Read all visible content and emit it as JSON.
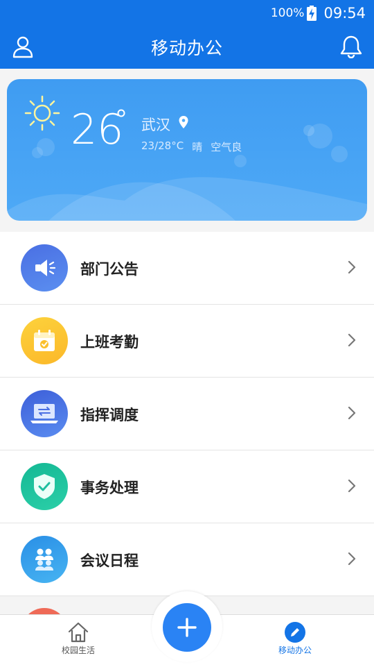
{
  "status_bar": {
    "battery": "100%",
    "time": "09:54"
  },
  "header": {
    "title": "移动办公"
  },
  "weather": {
    "temperature": "26",
    "city": "武汉",
    "range": "23/28°C",
    "condition": "晴",
    "air": "空气良"
  },
  "menu": [
    {
      "label": "部门公告",
      "icon": "megaphone-icon",
      "color": "#4a6fe3"
    },
    {
      "label": "上班考勤",
      "icon": "calendar-check-icon",
      "color": "#fbc02d"
    },
    {
      "label": "指挥调度",
      "icon": "laptop-transfer-icon",
      "color": "#3f6ee0"
    },
    {
      "label": "事务处理",
      "icon": "shield-check-icon",
      "color": "#1fbfa0"
    },
    {
      "label": "会议日程",
      "icon": "meeting-people-icon",
      "color": "#2f9fe8"
    }
  ],
  "bottom_nav": {
    "campus_label": "校园生活",
    "office_label": "移动办公",
    "accent": "#1374e6"
  }
}
